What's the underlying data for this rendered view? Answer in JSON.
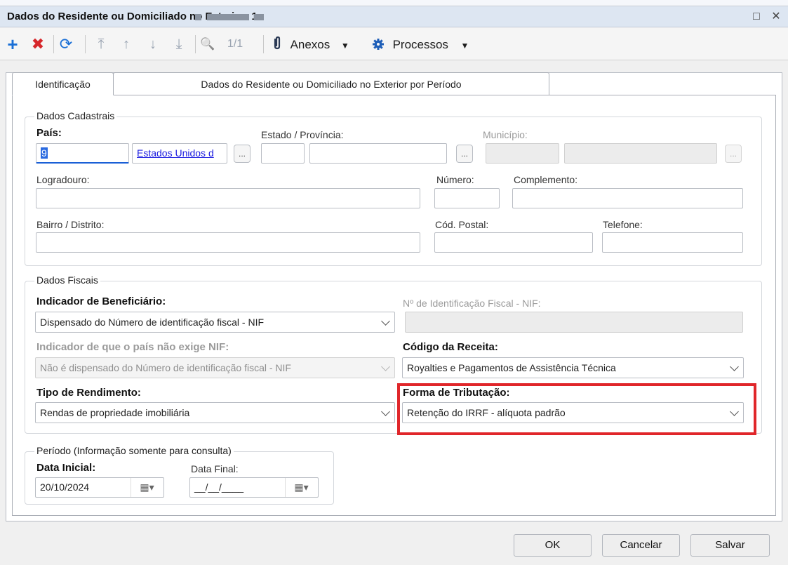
{
  "window": {
    "title": "Dados do Residente ou Domiciliado no Exterior: 1",
    "maximize_glyph": "□",
    "close_glyph": "✕"
  },
  "toolbar": {
    "add_icon": "+",
    "delete_icon": "✖",
    "refresh_icon": "⟳",
    "first_icon": "⤒",
    "prev_icon": "↑",
    "next_icon": "↓",
    "last_icon": "⤓",
    "search_icon": "🔍",
    "record_counter": "1/1",
    "attachments_label": "Anexos",
    "processes_label": "Processos",
    "dropdown_arrow": "▼",
    "colors": {
      "add": "#1a6fd6",
      "delete": "#d6262a",
      "refresh": "#1a6fd6",
      "disabled": "#9aa4b2"
    }
  },
  "tabs": [
    {
      "label": "Identificação"
    },
    {
      "label": "Dados do Residente ou Domiciliado no Exterior por Período"
    }
  ],
  "cadastrais": {
    "group_title": "Dados Cadastrais",
    "pais_label": "País:",
    "pais_code": "9",
    "pais_name": "Estados Unidos d",
    "estado_label": "Estado / Província:",
    "municipio_label": "Município:",
    "lookup_glyph": "...",
    "logradouro_label": "Logradouro:",
    "numero_label": "Número:",
    "complemento_label": "Complemento:",
    "bairro_label": "Bairro / Distrito:",
    "cod_postal_label": "Cód. Postal:",
    "telefone_label": "Telefone:"
  },
  "fiscais": {
    "group_title": "Dados Fiscais",
    "indicador_beneficiario_label": "Indicador de Beneficiário:",
    "indicador_beneficiario_value": "Dispensado do Número de identificação fiscal - NIF",
    "nif_label": "Nº de Identificação Fiscal - NIF:",
    "indicador_pais_label": "Indicador de que o país não exige NIF:",
    "indicador_pais_value": "Não é dispensado do Número de identificação fiscal - NIF",
    "codigo_receita_label": "Código da Receita:",
    "codigo_receita_value": "Royalties e Pagamentos de Assistência Técnica",
    "tipo_rendimento_label": "Tipo de Rendimento:",
    "tipo_rendimento_value": "Rendas de propriedade imobiliária",
    "forma_tributacao_label": "Forma de Tributação:",
    "forma_tributacao_value": "Retenção do IRRF - alíquota padrão",
    "highlight_color": "#e0262a"
  },
  "periodo": {
    "group_title": "Período (Informação somente para consulta)",
    "data_inicial_label": "Data Inicial:",
    "data_inicial_value": "20/10/2024",
    "data_final_label": "Data Final:",
    "data_final_value": "__/__/____",
    "calendar_glyph": "▦▾"
  },
  "buttons": {
    "ok": "OK",
    "cancel": "Cancelar",
    "save": "Salvar"
  }
}
